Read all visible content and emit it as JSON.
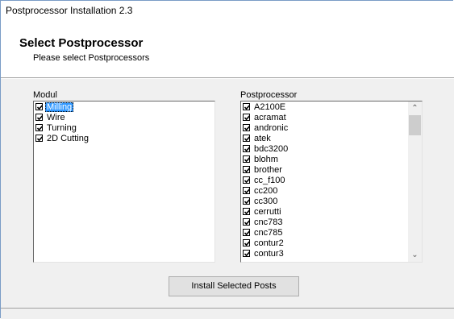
{
  "window": {
    "title": "Postprocessor Installation 2.3"
  },
  "header": {
    "title": "Select Postprocessor",
    "subtitle": "Please select Postprocessors"
  },
  "modul": {
    "label": "Modul",
    "items": [
      {
        "label": "Milling",
        "checked": true,
        "selected": true
      },
      {
        "label": "Wire",
        "checked": true,
        "selected": false
      },
      {
        "label": "Turning",
        "checked": true,
        "selected": false
      },
      {
        "label": "2D Cutting",
        "checked": true,
        "selected": false
      }
    ]
  },
  "postprocessor": {
    "label": "Postprocessor",
    "items": [
      {
        "label": "A2100E",
        "checked": true
      },
      {
        "label": "acramat",
        "checked": true
      },
      {
        "label": "andronic",
        "checked": true
      },
      {
        "label": "atek",
        "checked": true
      },
      {
        "label": "bdc3200",
        "checked": true
      },
      {
        "label": "blohm",
        "checked": true
      },
      {
        "label": "brother",
        "checked": true
      },
      {
        "label": "cc_f100",
        "checked": true
      },
      {
        "label": "cc200",
        "checked": true
      },
      {
        "label": "cc300",
        "checked": true
      },
      {
        "label": "cerrutti",
        "checked": true
      },
      {
        "label": "cnc783",
        "checked": true
      },
      {
        "label": "cnc785",
        "checked": true
      },
      {
        "label": "contur2",
        "checked": true
      },
      {
        "label": "contur3",
        "checked": true
      }
    ]
  },
  "install_button": {
    "label": "Install Selected Posts"
  }
}
